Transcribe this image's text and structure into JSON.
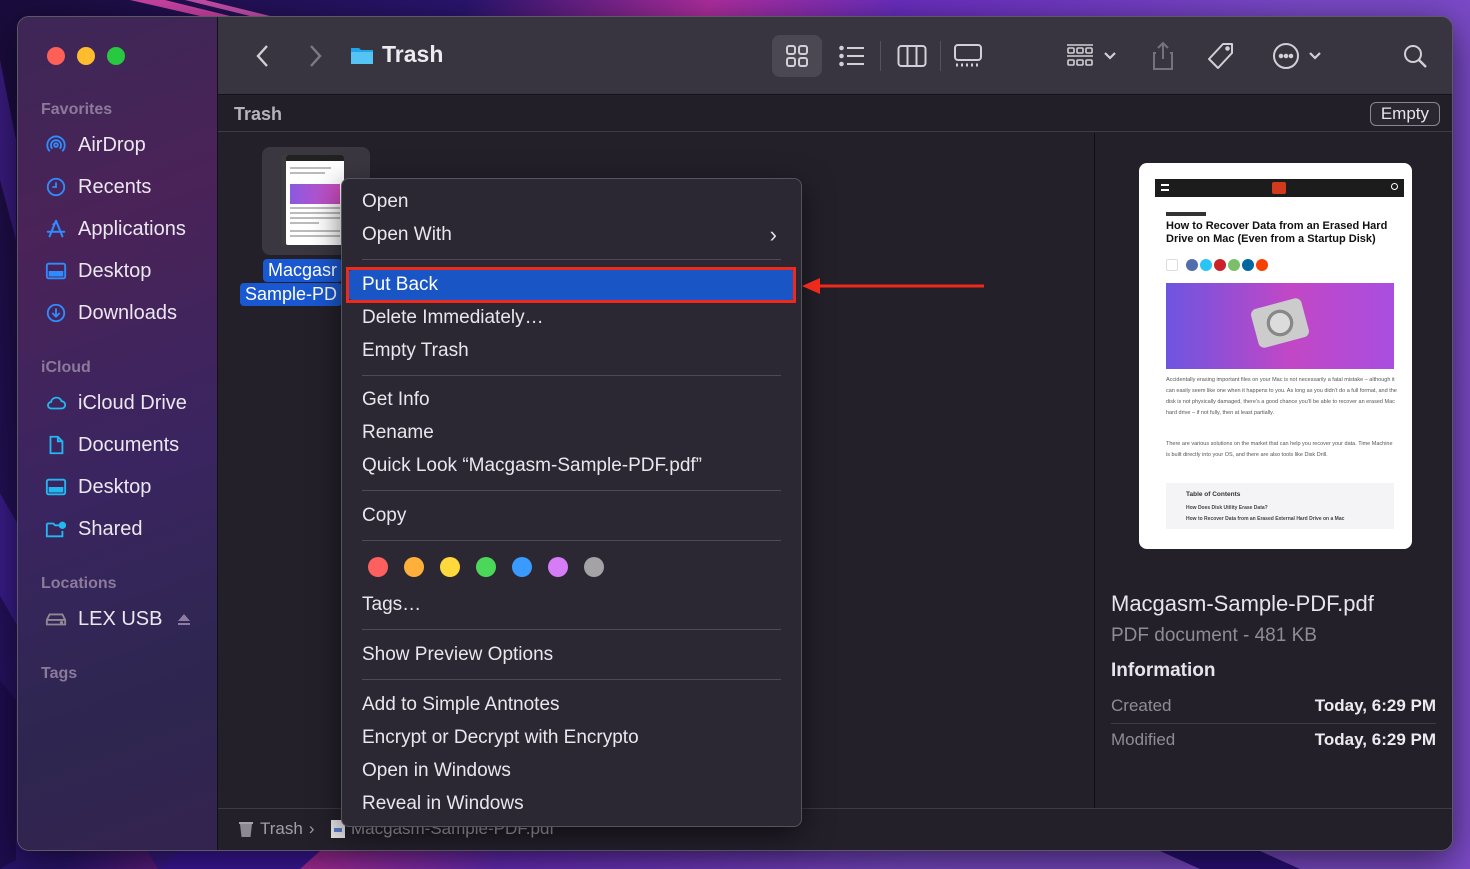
{
  "window": {
    "title": "Trash",
    "path_header": "Trash",
    "empty_button": "Empty"
  },
  "toolbar": {
    "back": "back",
    "forward": "forward",
    "views": [
      "icon-view",
      "list-view",
      "column-view",
      "gallery-view"
    ],
    "active_view": "icon-view",
    "group_by": "group-by",
    "share": "share",
    "tags": "tags",
    "more": "more-actions",
    "search": "search"
  },
  "sidebar": {
    "sections": [
      {
        "title": "Favorites",
        "items": [
          {
            "label": "AirDrop",
            "icon": "airdrop-icon"
          },
          {
            "label": "Recents",
            "icon": "clock-icon"
          },
          {
            "label": "Applications",
            "icon": "applications-icon"
          },
          {
            "label": "Desktop",
            "icon": "desktop-icon"
          },
          {
            "label": "Downloads",
            "icon": "download-icon"
          }
        ]
      },
      {
        "title": "iCloud",
        "items": [
          {
            "label": "iCloud Drive",
            "icon": "cloud-icon"
          },
          {
            "label": "Documents",
            "icon": "document-icon"
          },
          {
            "label": "Desktop",
            "icon": "desktop-icon"
          },
          {
            "label": "Shared",
            "icon": "shared-folder-icon"
          }
        ]
      },
      {
        "title": "Locations",
        "items": [
          {
            "label": "LEX USB",
            "icon": "drive-icon",
            "eject": true
          }
        ]
      },
      {
        "title": "Tags",
        "items": []
      }
    ]
  },
  "file": {
    "name_line1": "Macgasm-",
    "name_line2": "Sample-PDF.pdf",
    "name_visible_line1": "Macgasr",
    "name_visible_line2": "Sample-PD",
    "full_name": "Macgasm-Sample-PDF.pdf"
  },
  "context_menu": {
    "items": [
      {
        "label": "Open"
      },
      {
        "label": "Open With",
        "submenu": true
      },
      {
        "label": "Put Back",
        "highlighted": true
      },
      {
        "label": "Delete Immediately…"
      },
      {
        "label": "Empty Trash"
      },
      {
        "label": "Get Info"
      },
      {
        "label": "Rename"
      },
      {
        "label": "Quick Look “Macgasm-Sample-PDF.pdf”"
      },
      {
        "label": "Copy"
      },
      {
        "label": "Tags…"
      },
      {
        "label": "Show Preview Options"
      },
      {
        "label": "Add to Simple Antnotes"
      },
      {
        "label": "Encrypt or Decrypt with Encrypto"
      },
      {
        "label": "Open in Windows"
      },
      {
        "label": "Reveal in Windows"
      }
    ],
    "tag_colors": [
      {
        "name": "red",
        "color": "#fe5f5f"
      },
      {
        "name": "orange",
        "color": "#ffb03b"
      },
      {
        "name": "yellow",
        "color": "#ffd93b"
      },
      {
        "name": "green",
        "color": "#4bd85a"
      },
      {
        "name": "blue",
        "color": "#3a9bff"
      },
      {
        "name": "purple",
        "color": "#d57cf6"
      },
      {
        "name": "gray",
        "color": "#a3a3a6"
      }
    ]
  },
  "annotation": {
    "highlight_color": "#ee2a1c",
    "arrow_target": "Put Back"
  },
  "preview": {
    "doc_title": "How to Recover Data from an Erased Hard Drive on Mac (Even from a Startup Disk)",
    "paragraph1": "Accidentally erasing important files on your Mac is not necessarily a fatal mistake – although it can easily seem like one when it happens to you. As long as you didn’t do a full format, and the disk is not physically damaged, there’s a good chance you’ll be able to recover an erased Mac hard drive – if not fully, then at least partially.",
    "paragraph2": "There are various solutions on the market that can help you recover your data. Time Machine is built directly into your OS, and there are also tools like Disk Drill.",
    "toc_title": "Table of Contents",
    "toc_items": [
      "How Does Disk Utility Erase Data?",
      "How to Recover Data from an Erased External Hard Drive on a Mac"
    ],
    "file_name": "Macgasm-Sample-PDF.pdf",
    "kind_size": "PDF document - 481 KB",
    "info_heading": "Information",
    "info": [
      {
        "key": "Created",
        "value": "Today, 6:29 PM"
      },
      {
        "key": "Modified",
        "value": "Today, 6:29 PM"
      }
    ]
  },
  "statusbar": {
    "crumbs": [
      "Trash",
      "Macgasm-Sample-PDF.pdf"
    ]
  }
}
